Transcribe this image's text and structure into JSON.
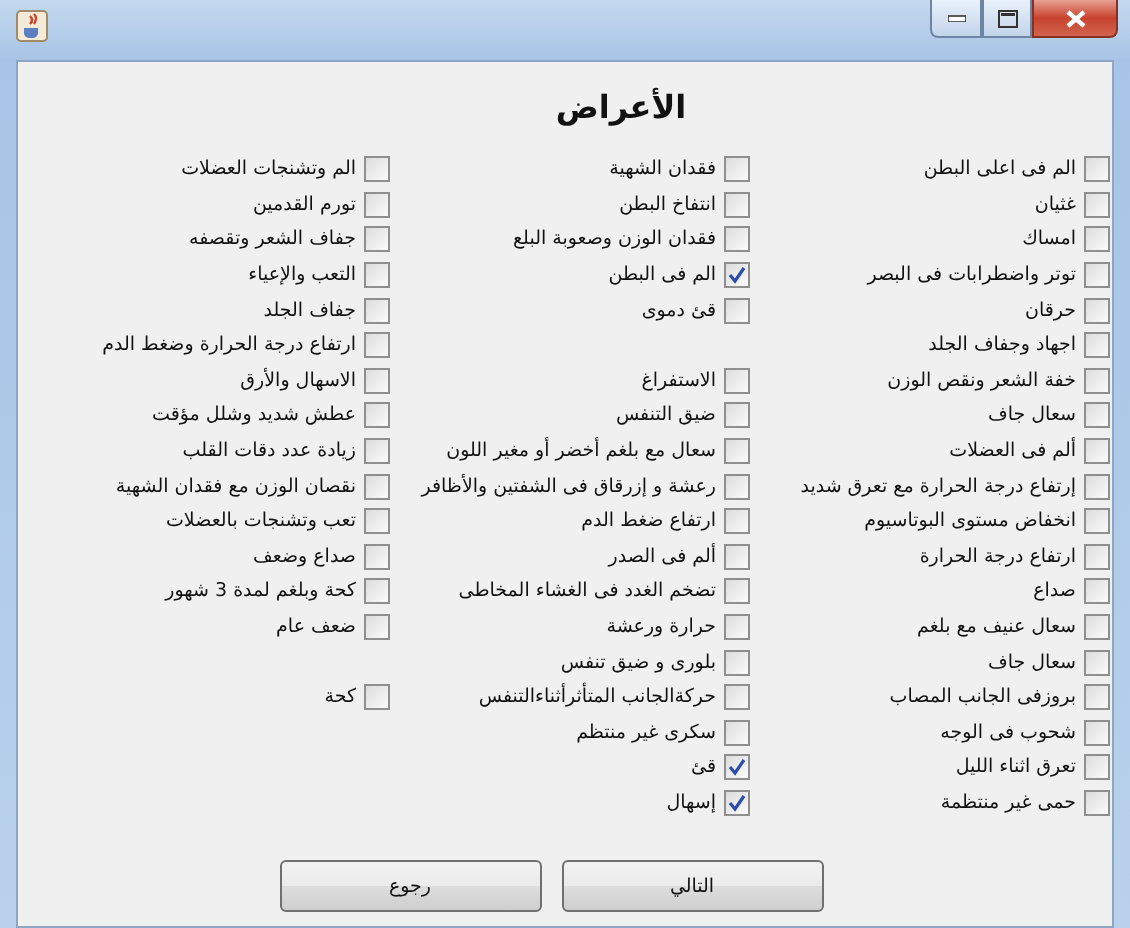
{
  "heading": "الأعراض",
  "columns": [
    [
      {
        "kind": "checkbox",
        "label": "الم فى اعلى البطن",
        "checked": false
      },
      {
        "kind": "checkbox",
        "label": "غثيان",
        "checked": false
      },
      {
        "kind": "checkbox",
        "label": "امساك",
        "checked": false
      },
      {
        "kind": "checkbox",
        "label": "توتر واضطرابات فى البصر",
        "checked": false
      },
      {
        "kind": "checkbox",
        "label": "حرقان",
        "checked": false
      },
      {
        "kind": "checkbox",
        "label": "اجهاد وجفاف الجلد",
        "checked": false
      },
      {
        "kind": "checkbox",
        "label": "خفة الشعر ونقص الوزن",
        "checked": false
      },
      {
        "kind": "checkbox",
        "label": "سعال جاف",
        "checked": false
      },
      {
        "kind": "checkbox",
        "label": "ألم فى العضلات",
        "checked": false
      },
      {
        "kind": "checkbox",
        "label": "إرتفاع درجة الحرارة مع تعرق شديد",
        "checked": false
      },
      {
        "kind": "checkbox",
        "label": "انخفاض مستوى البوتاسيوم",
        "checked": false
      },
      {
        "kind": "checkbox",
        "label": "ارتفاع درجة الحرارة",
        "checked": false
      },
      {
        "kind": "checkbox",
        "label": "صداع",
        "checked": false
      },
      {
        "kind": "checkbox",
        "label": "سعال عنيف مع بلغم",
        "checked": false
      },
      {
        "kind": "checkbox",
        "label": "سعال جاف",
        "checked": false
      },
      {
        "kind": "checkbox",
        "label": "بروزفى الجانب المصاب",
        "checked": false
      },
      {
        "kind": "checkbox",
        "label": "شحوب فى الوجه",
        "checked": false
      },
      {
        "kind": "checkbox",
        "label": "تعرق اثناء الليل",
        "checked": false
      },
      {
        "kind": "checkbox",
        "label": "حمى غير منتظمة",
        "checked": false
      }
    ],
    [
      {
        "kind": "checkbox",
        "label": "فقدان الشهية",
        "checked": false
      },
      {
        "kind": "checkbox",
        "label": "انتفاخ البطن",
        "checked": false
      },
      {
        "kind": "checkbox",
        "label": "فقدان الوزن وصعوبة البلع",
        "checked": false
      },
      {
        "kind": "checkbox",
        "label": "الم فى البطن",
        "checked": true
      },
      {
        "kind": "checkbox",
        "label": "قئ دموى",
        "checked": false
      },
      {
        "kind": "blank"
      },
      {
        "kind": "checkbox",
        "label": "الاستفراغ",
        "checked": false
      },
      {
        "kind": "checkbox",
        "label": "ضيق التنفس",
        "checked": false
      },
      {
        "kind": "checkbox",
        "label": "سعال مع بلغم أخضر أو مغير اللون",
        "checked": false
      },
      {
        "kind": "checkbox",
        "label": "رعشة و إزرقاق فى الشفتين والأظافر",
        "checked": false
      },
      {
        "kind": "checkbox",
        "label": "ارتفاع ضغط الدم",
        "checked": false
      },
      {
        "kind": "checkbox",
        "label": "ألم فى الصدر",
        "checked": false
      },
      {
        "kind": "checkbox",
        "label": "تضخم الغدد فى الغشاء المخاطى",
        "checked": false
      },
      {
        "kind": "checkbox",
        "label": "حرارة ورعشة",
        "checked": false
      },
      {
        "kind": "checkbox",
        "label": "بلورى و ضيق تنفس",
        "checked": false
      },
      {
        "kind": "checkbox",
        "label": "حركةالجانب المتأثرأثناءالتنفس",
        "checked": false
      },
      {
        "kind": "checkbox",
        "label": "سكرى غير منتظم",
        "checked": false
      },
      {
        "kind": "checkbox",
        "label": "قئ",
        "checked": true
      },
      {
        "kind": "checkbox",
        "label": "إسهال",
        "checked": true
      }
    ],
    [
      {
        "kind": "checkbox",
        "label": "الم وتشنجات العضلات",
        "checked": false
      },
      {
        "kind": "checkbox",
        "label": "تورم القدمين",
        "checked": false
      },
      {
        "kind": "checkbox",
        "label": "جفاف الشعر وتقصفه",
        "checked": false
      },
      {
        "kind": "checkbox",
        "label": "التعب والإعياء",
        "checked": false
      },
      {
        "kind": "checkbox",
        "label": "جفاف الجلد",
        "checked": false
      },
      {
        "kind": "checkbox",
        "label": "ارتفاع درجة الحرارة وضغط الدم",
        "checked": false
      },
      {
        "kind": "checkbox",
        "label": "الاسهال والأرق",
        "checked": false
      },
      {
        "kind": "checkbox",
        "label": "عطش شديد وشلل مؤقت",
        "checked": false
      },
      {
        "kind": "checkbox",
        "label": "زيادة عدد دقات القلب",
        "checked": false
      },
      {
        "kind": "checkbox",
        "label": "نقصان الوزن مع فقدان الشهية",
        "checked": false
      },
      {
        "kind": "checkbox",
        "label": "تعب وتشنجات بالعضلات",
        "checked": false
      },
      {
        "kind": "checkbox",
        "label": "صداع وضعف",
        "checked": false
      },
      {
        "kind": "checkbox",
        "label": "كحة وبلغم لمدة 3 شهور",
        "checked": false
      },
      {
        "kind": "checkbox",
        "label": "ضعف عام",
        "checked": false
      },
      {
        "kind": "blank"
      },
      {
        "kind": "checkbox",
        "label": "كحة",
        "checked": false
      }
    ]
  ],
  "buttons": [
    {
      "label": "التالي"
    },
    {
      "label": "رجوع"
    }
  ]
}
